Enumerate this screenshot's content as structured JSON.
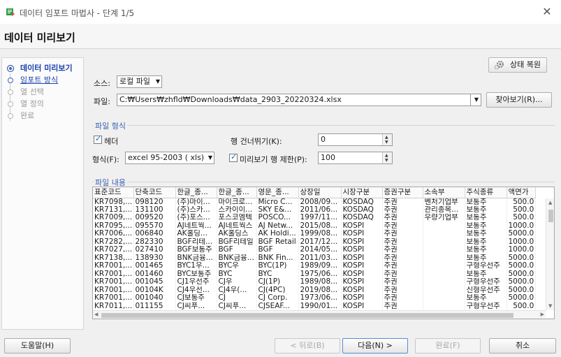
{
  "window": {
    "title": "데이터 임포트 마법사 - 단계 1/5",
    "close": "✕"
  },
  "header": {
    "heading": "데이터 미리보기"
  },
  "steps": [
    {
      "label": "데이터 미리보기",
      "state": "active"
    },
    {
      "label": "임포트 방식",
      "state": "link"
    },
    {
      "label": "열 선택",
      "state": "disabled"
    },
    {
      "label": "열 정의",
      "state": "disabled"
    },
    {
      "label": "완료",
      "state": "disabled"
    }
  ],
  "toolbar": {
    "restore_label": "상태 복원"
  },
  "source": {
    "label": "소스:",
    "value": "로컬 파일"
  },
  "file": {
    "label": "파일:",
    "value": "C:₩Users₩zhfld₩Downloads₩data_2903_20220324.xlsx",
    "browse_label": "찾아보기(R)..."
  },
  "file_format": {
    "group_title": "파일 형식",
    "header_label": "헤더",
    "header_checked": true,
    "skip_rows_label": "행 건너뛰기(K):",
    "skip_rows_value": "0",
    "format_label": "형식(F):",
    "format_value": "excel 95-2003 ( xls)",
    "preview_limit_label": "미리보기 행 제한(P):",
    "preview_limit_checked": true,
    "preview_limit_value": "100"
  },
  "file_content": {
    "group_title": "파일 내용",
    "columns": [
      "표준코드",
      "단축코드",
      "한글_종...",
      "한글_종...",
      "영문_종...",
      "상장일",
      "시장구분",
      "증권구분",
      "소속부",
      "주식종류",
      "액면가"
    ],
    "rows": [
      [
        "KR7098,...",
        "098120",
        "(주)마이...",
        "마이크로...",
        "Micro C...",
        "2008/09...",
        "KOSDAQ",
        "주권",
        "벤처기업부",
        "보통주",
        "500.0"
      ],
      [
        "KR7131,...",
        "131100",
        "(주)스카...",
        "스카이이...",
        "SKY E&...",
        "2011/06...",
        "KOSDAQ",
        "주권",
        "관리종목...",
        "보통주",
        "500.0"
      ],
      [
        "KR7009,...",
        "009520",
        "(주)포스...",
        "포스코엠텍",
        "POSCO...",
        "1997/11...",
        "KOSDAQ",
        "주권",
        "우량기업부",
        "보통주",
        "500.0"
      ],
      [
        "KR7095,...",
        "095570",
        "AJ네트웍...",
        "AJ네트웍스",
        "AJ Netw...",
        "2015/08...",
        "KOSPI",
        "주권",
        "",
        "보통주",
        "1000.0"
      ],
      [
        "KR7006,...",
        "006840",
        "AK홀딩...",
        "AK홀딩스",
        "AK Holdi...",
        "1999/08...",
        "KOSPI",
        "주권",
        "",
        "보통주",
        "5000.0"
      ],
      [
        "KR7282,...",
        "282330",
        "BGF리테...",
        "BGF리테일",
        "BGF Retail",
        "2017/12...",
        "KOSPI",
        "주권",
        "",
        "보통주",
        "1000.0"
      ],
      [
        "KR7027,...",
        "027410",
        "BGF보통주",
        "BGF",
        "BGF",
        "2014/05...",
        "KOSPI",
        "주권",
        "",
        "보통주",
        "1000.0"
      ],
      [
        "KR7138,...",
        "138930",
        "BNK금융...",
        "BNK금융...",
        "BNK Fin...",
        "2011/03...",
        "KOSPI",
        "주권",
        "",
        "보통주",
        "5000.0"
      ],
      [
        "KR7001,...",
        "001465",
        "BYC1우...",
        "BYC우",
        "BYC(1P)",
        "1989/09...",
        "KOSPI",
        "주권",
        "",
        "구형우선주",
        "5000.0"
      ],
      [
        "KR7001,...",
        "001460",
        "BYC보통주",
        "BYC",
        "BYC",
        "1975/06...",
        "KOSPI",
        "주권",
        "",
        "보통주",
        "5000.0"
      ],
      [
        "KR7001,...",
        "001045",
        "CJ1우선주",
        "CJ우",
        "CJ(1P)",
        "1989/08...",
        "KOSPI",
        "주권",
        "",
        "구형우선주",
        "5000.0"
      ],
      [
        "KR7001,...",
        "00104K",
        "CJ4우선...",
        "CJ4우(...",
        "CJ(4PC)",
        "2019/08...",
        "KOSPI",
        "주권",
        "",
        "신형우선주",
        "5000.0"
      ],
      [
        "KR7001,...",
        "001040",
        "CJ보통주",
        "CJ",
        "CJ Corp.",
        "1973/06...",
        "KOSPI",
        "주권",
        "",
        "보통주",
        "5000.0"
      ],
      [
        "KR7011,...",
        "011155",
        "CJ씨푸...",
        "CJ씨푸...",
        "CJSEAF...",
        "1990/01...",
        "KOSPI",
        "주권",
        "",
        "구형우선주",
        "500.0"
      ]
    ]
  },
  "footer": {
    "help_label": "도움말(H)",
    "back_label": "< 뒤로(B)",
    "next_label": "다음(N) >",
    "finish_label": "완료(F)",
    "cancel_label": "취소"
  },
  "colors": {
    "accent": "#3b61b5",
    "link": "#1a3fb0",
    "app_icon": "#2e9e48"
  }
}
